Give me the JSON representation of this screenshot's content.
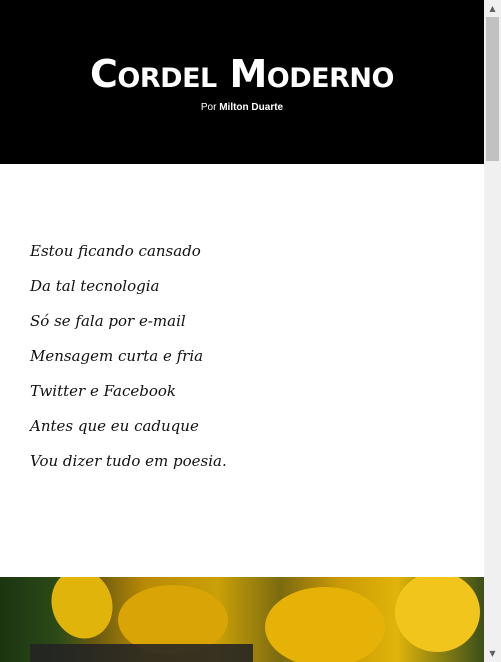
{
  "header": {
    "title": "Cordel Moderno",
    "byline_prefix": "Por",
    "author": "Milton Duarte"
  },
  "poem": {
    "verses": [
      "Estou ficando cansado",
      "Da tal tecnologia",
      "Só se fala por e-mail",
      "Mensagem curta e fria",
      "Twitter e Facebook",
      "Antes que eu caduque",
      "Vou dizer tudo em poesia."
    ]
  },
  "footer_image": {
    "subject": "yellow flowers"
  },
  "scrollbar": {
    "up_icon": "▲",
    "down_icon": "▼"
  }
}
